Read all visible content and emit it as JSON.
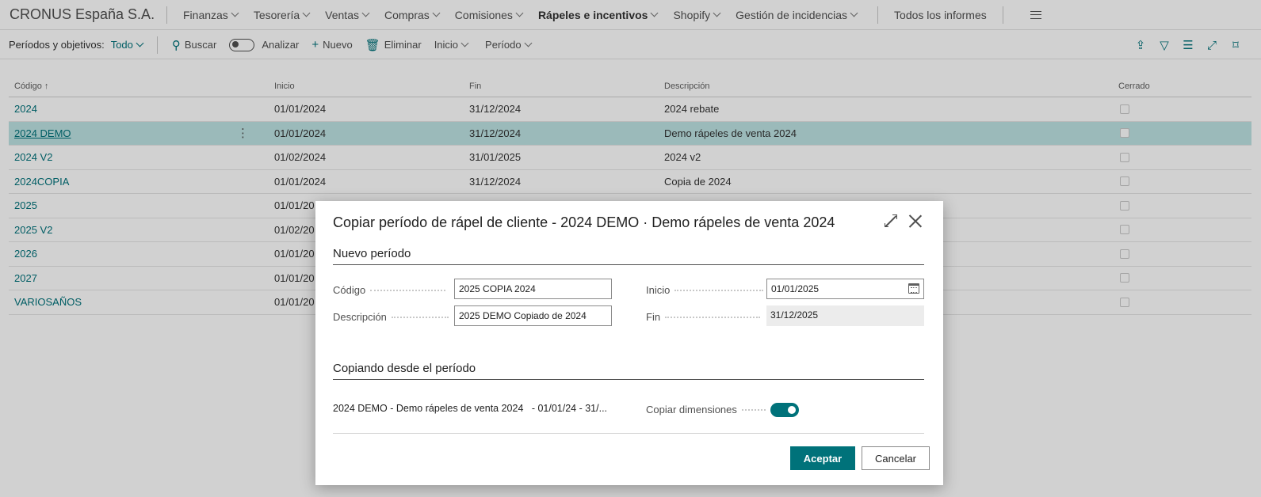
{
  "topnav": {
    "company": "CRONUS España S.A.",
    "items": [
      {
        "label": "Finanzas"
      },
      {
        "label": "Tesorería"
      },
      {
        "label": "Ventas"
      },
      {
        "label": "Compras"
      },
      {
        "label": "Comisiones"
      },
      {
        "label": "Rápeles e incentivos"
      },
      {
        "label": "Shopify"
      },
      {
        "label": "Gestión de incidencias"
      }
    ],
    "all_reports": "Todos los informes"
  },
  "actionbar": {
    "filter_label": "Períodos y objetivos:",
    "filter_value": "Todo",
    "search": "Buscar",
    "analyze": "Analizar",
    "new": "Nuevo",
    "delete": "Eliminar",
    "home": "Inicio",
    "period": "Período"
  },
  "grid": {
    "columns": {
      "code": "Código",
      "start": "Inicio",
      "end": "Fin",
      "description": "Descripción",
      "closed": "Cerrado"
    },
    "rows": [
      {
        "code": "2024",
        "start": "01/01/2024",
        "end": "31/12/2024",
        "description": "2024 rebate"
      },
      {
        "code": "2024 DEMO",
        "start": "01/01/2024",
        "end": "31/12/2024",
        "description": "Demo rápeles de venta 2024"
      },
      {
        "code": "2024 V2",
        "start": "01/02/2024",
        "end": "31/01/2025",
        "description": "2024 v2"
      },
      {
        "code": "2024COPIA",
        "start": "01/01/2024",
        "end": "31/12/2024",
        "description": "Copia de 2024"
      },
      {
        "code": "2025",
        "start": "01/01/20",
        "end": "",
        "description": ""
      },
      {
        "code": "2025 V2",
        "start": "01/02/20",
        "end": "",
        "description": ""
      },
      {
        "code": "2026",
        "start": "01/01/20",
        "end": "",
        "description": ""
      },
      {
        "code": "2027",
        "start": "01/01/20",
        "end": "",
        "description": ""
      },
      {
        "code": "VARIOSAÑOS",
        "start": "01/01/20",
        "end": "",
        "description": ""
      }
    ]
  },
  "dialog": {
    "title": "Copiar período de rápel de cliente - 2024 DEMO · Demo rápeles de venta 2024",
    "section_new": "Nuevo período",
    "code_label": "Código",
    "code_value": "2025 COPIA 2024",
    "desc_label": "Descripción",
    "desc_value": "2025 DEMO Copiado de 2024",
    "start_label": "Inicio",
    "start_value": "01/01/2025",
    "end_label": "Fin",
    "end_value": "31/12/2025",
    "section_copy": "Copiando desde el período",
    "source_text": "2024 DEMO - Demo rápeles de venta 2024   - 01/01/24 - 31/...",
    "copy_dims_label": "Copiar dimensiones",
    "copy_dims_on": true,
    "ok": "Aceptar",
    "cancel": "Cancelar"
  },
  "colors": {
    "accent": "#00727a",
    "selected_row": "#bde3e3"
  }
}
